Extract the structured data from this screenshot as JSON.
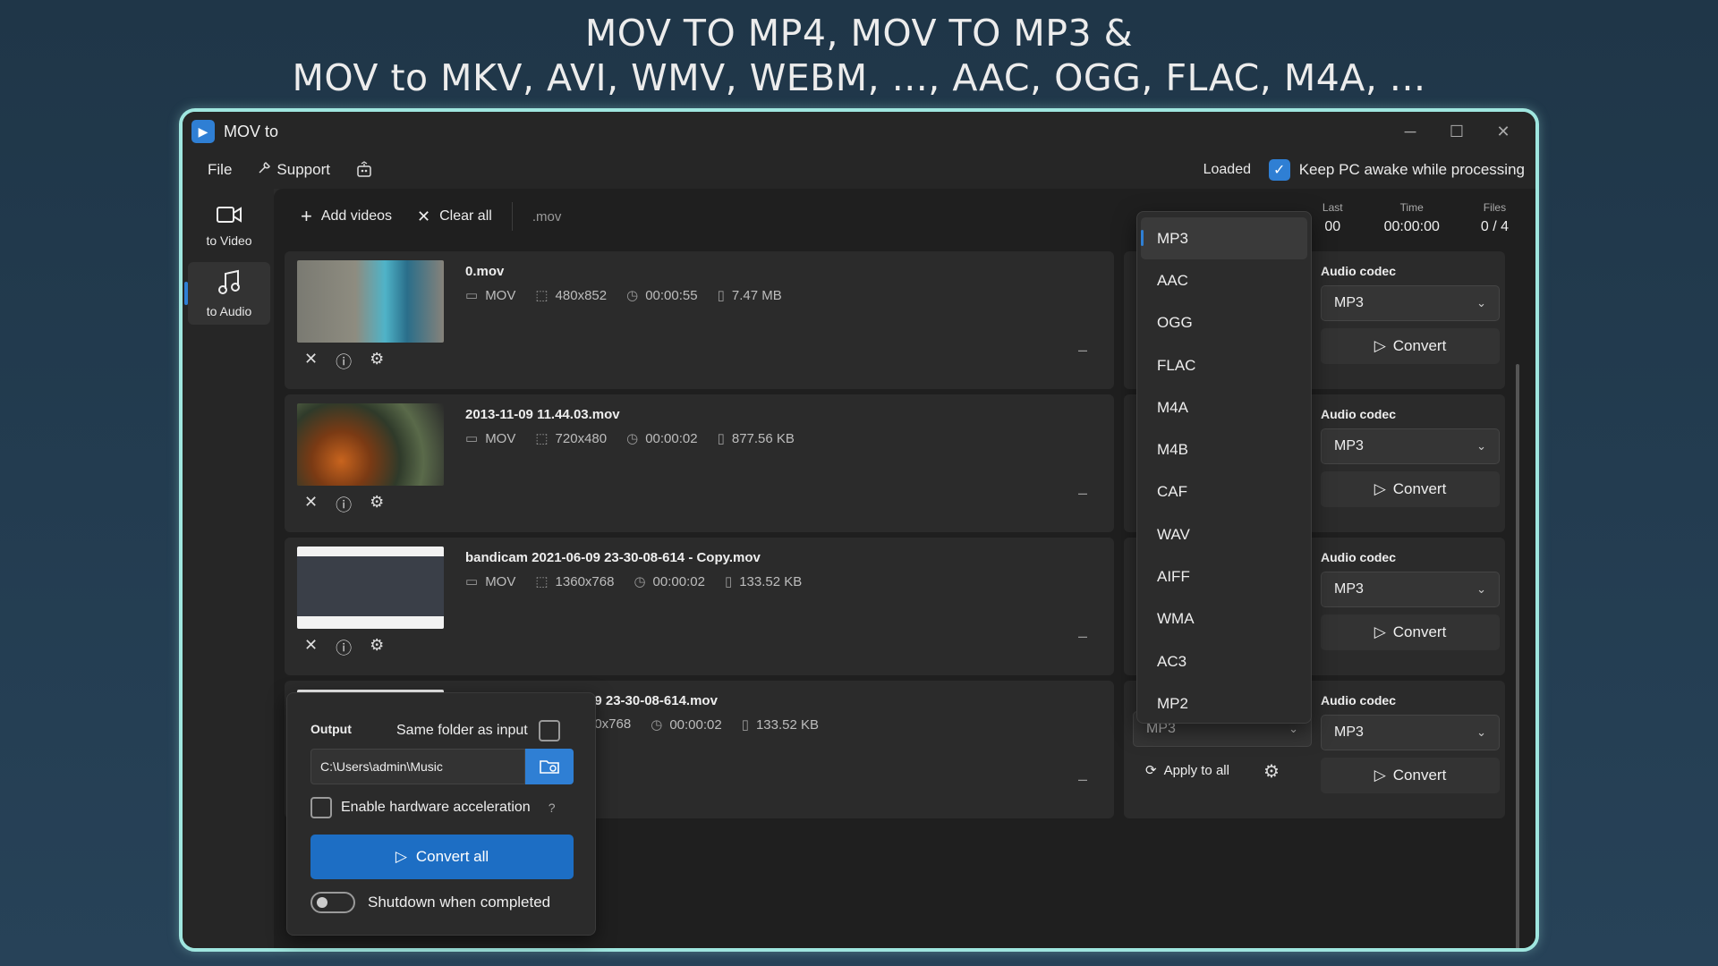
{
  "banner": {
    "line1": "MOV TO MP4, MOV TO MP3 &",
    "line2": "MOV to MKV, AVI, WMV, WEBM, ..., AAC, OGG, FLAC, M4A, ..."
  },
  "window": {
    "title": "MOV to",
    "controls": {
      "minimize": "─",
      "maximize": "☐",
      "close": "✕"
    }
  },
  "menu": {
    "file": "File",
    "support": "Support",
    "status": "Loaded",
    "keep_awake": "Keep PC awake while processing"
  },
  "sidebar": {
    "items": [
      {
        "label": "to Video",
        "icon": "video-camera-icon"
      },
      {
        "label": "to Audio",
        "icon": "music-note-icon"
      }
    ]
  },
  "toolbar": {
    "add_videos": "Add videos",
    "clear_all": "Clear all",
    "extension": ".mov"
  },
  "stats": {
    "col1_label": "Last",
    "col1_value": "00",
    "time_label": "Time",
    "time_value": "00:00:00",
    "files_label": "Files",
    "files_value": "0 / 4"
  },
  "files": [
    {
      "name": "0.mov",
      "format": "MOV",
      "resolution": "480x852",
      "duration": "00:00:55",
      "size": "7.47 MB"
    },
    {
      "name": "2013-11-09 11.44.03.mov",
      "format": "MOV",
      "resolution": "720x480",
      "duration": "00:00:02",
      "size": "877.56 KB"
    },
    {
      "name": "bandicam 2021-06-09 23-30-08-614 - Copy.mov",
      "format": "MOV",
      "resolution": "1360x768",
      "duration": "00:00:02",
      "size": "133.52 KB"
    },
    {
      "name": "09 23-30-08-614.mov",
      "format": "",
      "resolution": "60x768",
      "duration": "00:00:02",
      "size": "133.52 KB"
    }
  ],
  "codec_panel": {
    "label": "Audio codec",
    "value": "MP3",
    "convert": "Convert",
    "format_value": "MP3",
    "apply_all": "Apply to all"
  },
  "dropdown": {
    "selected": "MP3",
    "options": [
      "MP3",
      "AAC",
      "OGG",
      "FLAC",
      "M4A",
      "M4B",
      "CAF",
      "WAV",
      "AIFF",
      "WMA",
      "AC3",
      "MP2"
    ]
  },
  "output": {
    "label": "Output",
    "same_folder": "Same folder as input",
    "path": "C:\\Users\\admin\\Music",
    "hw_accel": "Enable hardware acceleration",
    "help": "?",
    "convert_all": "Convert all",
    "shutdown": "Shutdown when completed"
  },
  "colors": {
    "accent": "#2f7fd4",
    "frame": "#9fe6df",
    "background": "#1f3648"
  }
}
